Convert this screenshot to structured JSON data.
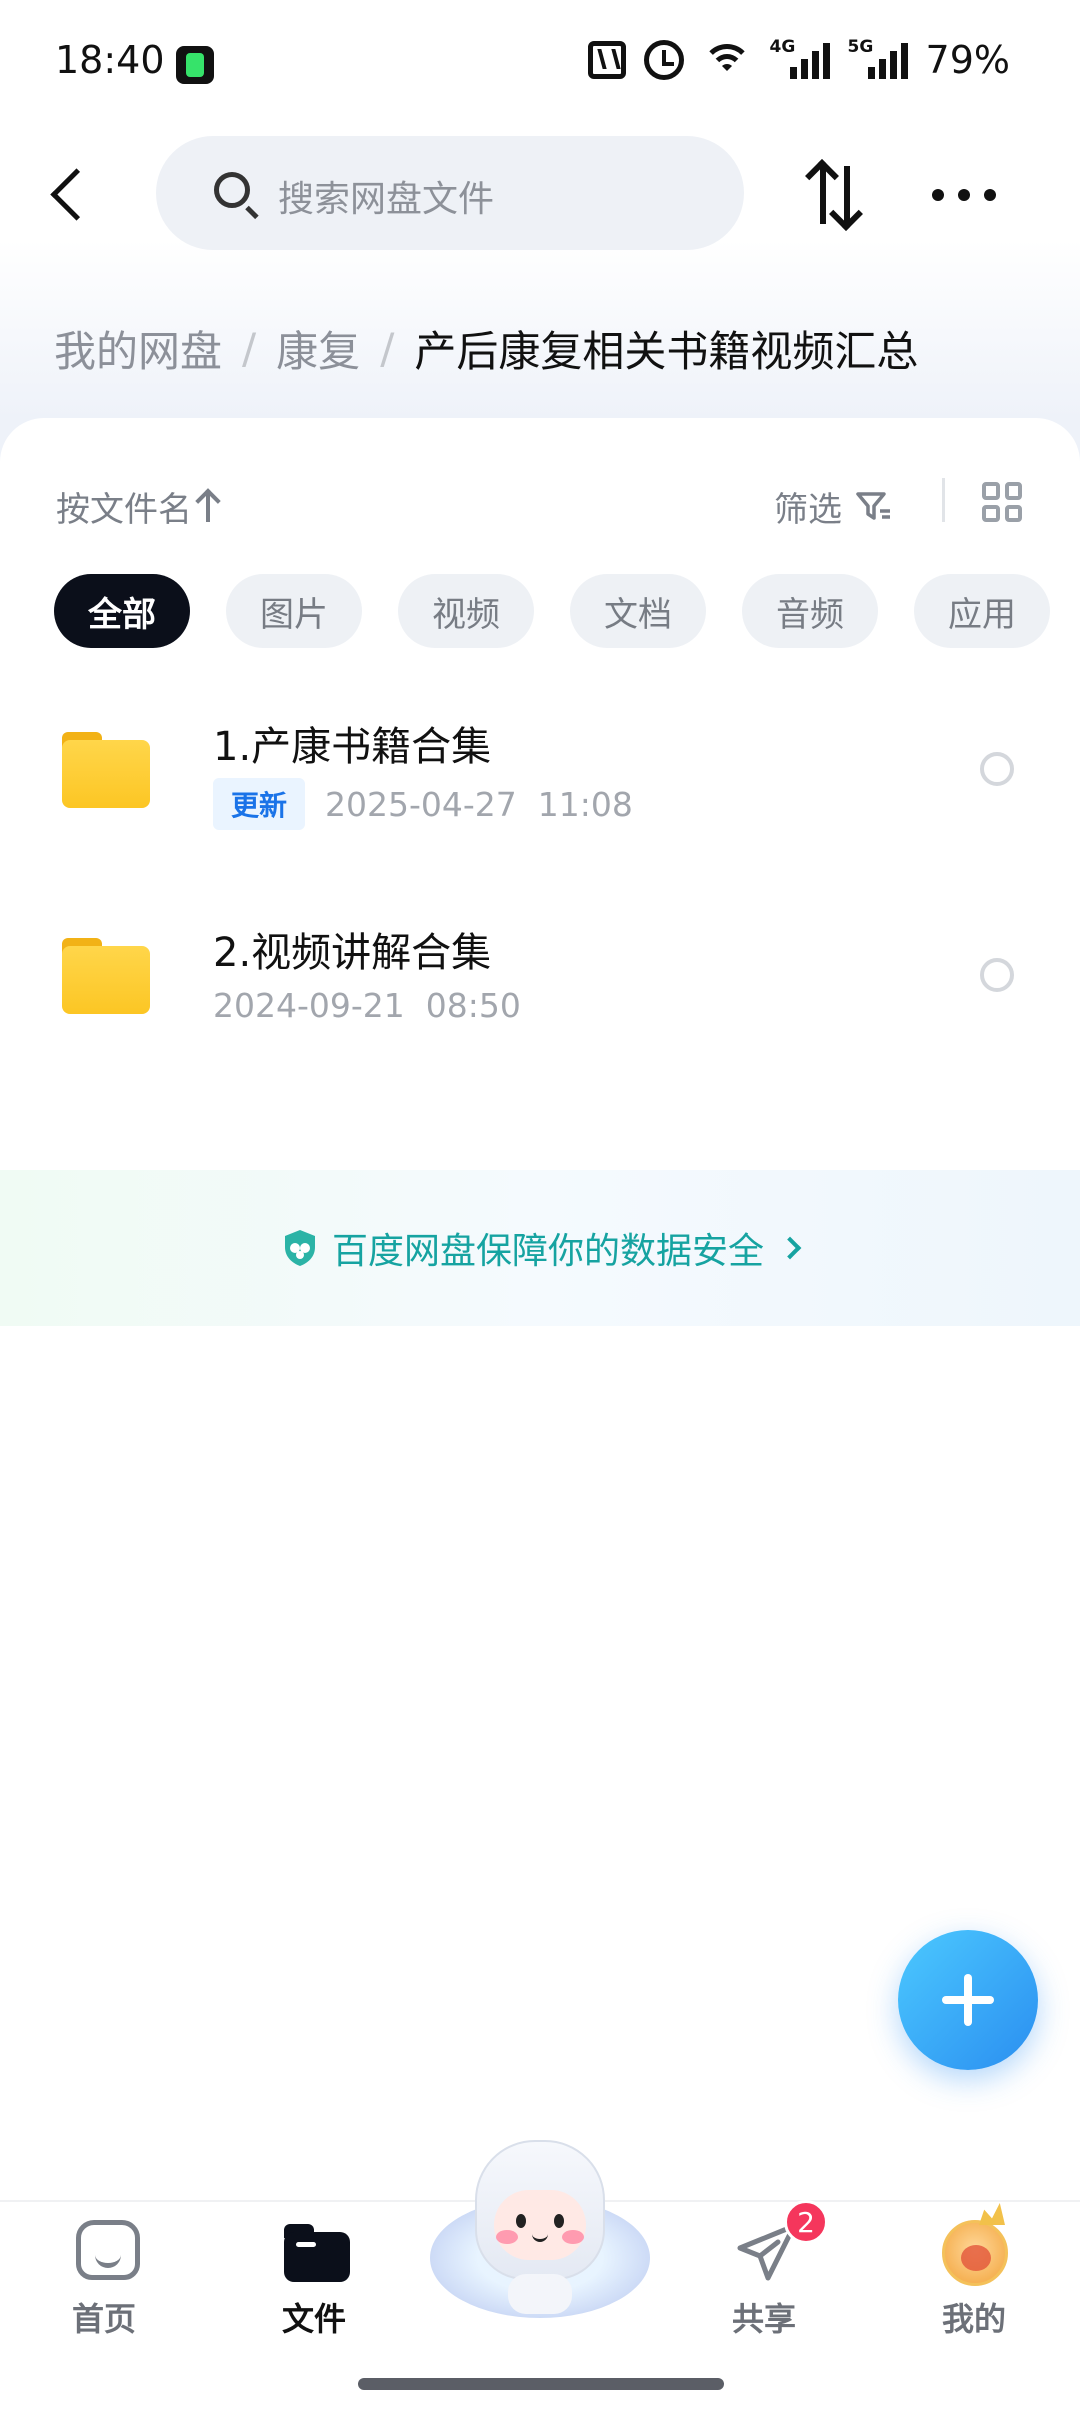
{
  "status_bar": {
    "time": "18:40",
    "network_4g": "4G",
    "network_5g": "5G",
    "battery": "79%"
  },
  "header": {
    "search_placeholder": "搜索网盘文件"
  },
  "breadcrumb": {
    "items": [
      "我的网盘",
      "康复",
      "产后康复相关书籍视频汇总"
    ],
    "separator": "/"
  },
  "toolbar": {
    "sort_label": "按文件名",
    "filter_label": "筛选"
  },
  "chips": [
    {
      "label": "全部",
      "active": true
    },
    {
      "label": "图片",
      "active": false
    },
    {
      "label": "视频",
      "active": false
    },
    {
      "label": "文档",
      "active": false
    },
    {
      "label": "音频",
      "active": false
    },
    {
      "label": "应用",
      "active": false
    }
  ],
  "files": [
    {
      "name": "1.产康书籍合集",
      "badge": "更新",
      "date": "2025-04-27",
      "time": "11:08"
    },
    {
      "name": "2.视频讲解合集",
      "badge": "",
      "date": "2024-09-21",
      "time": "08:50"
    }
  ],
  "security_banner": {
    "text": "百度网盘保障你的数据安全"
  },
  "bottom_nav": {
    "home": "首页",
    "files": "文件",
    "share": "共享",
    "share_badge": "2",
    "mine": "我的"
  },
  "colors": {
    "accent": "#2a8ef0",
    "security_text": "#16a3a1",
    "badge_red": "#f5365c",
    "folder_yellow": "#fcc624"
  }
}
